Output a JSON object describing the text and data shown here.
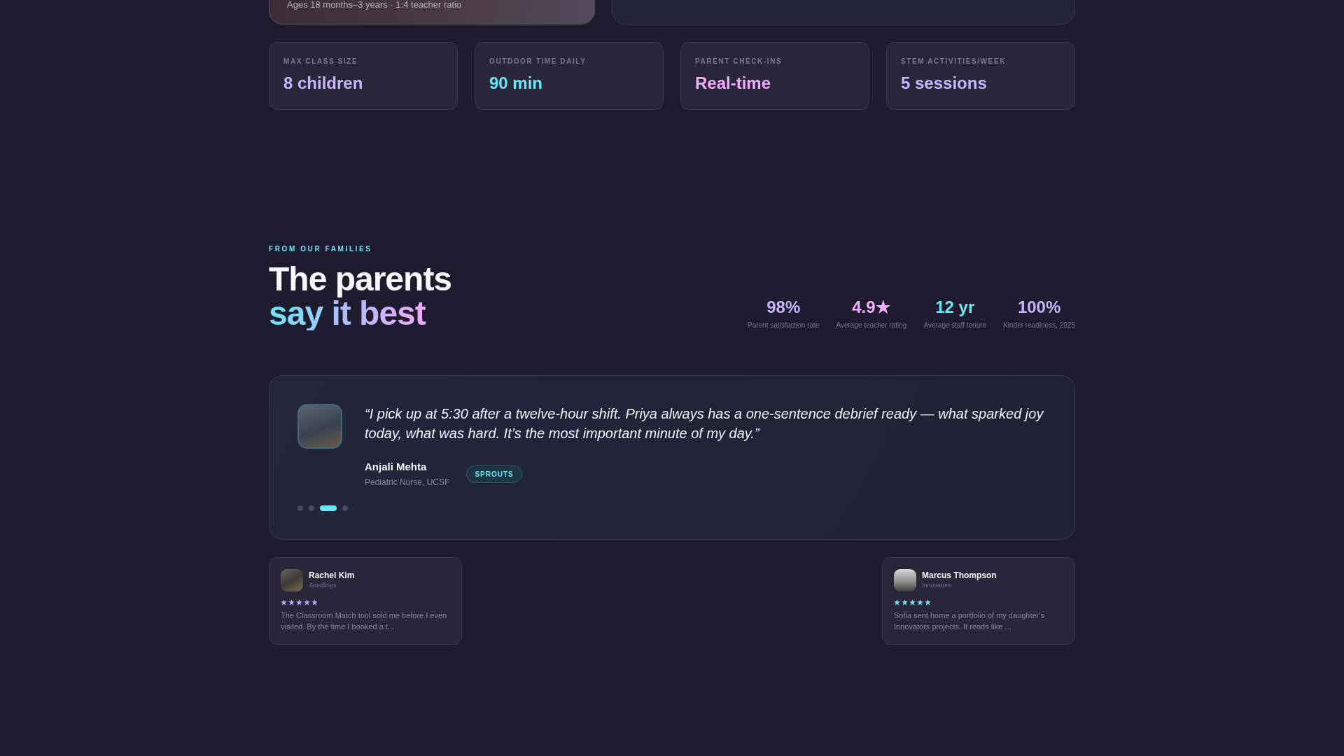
{
  "program_cards": [
    {
      "kind": "photo",
      "caption": "Ages 18 months–3 years · 1:4 teacher ratio"
    },
    {
      "kind": "plain"
    }
  ],
  "highlights": [
    {
      "label": "MAX CLASS SIZE",
      "value": "8 children",
      "color": "#c4b5fd"
    },
    {
      "label": "OUTDOOR TIME DAILY",
      "value": "90 min",
      "color": "#67e8f9"
    },
    {
      "label": "PARENT CHECK-INS",
      "value": "Real-time",
      "color": "#f0abfc"
    },
    {
      "label": "STEM ACTIVITIES/WEEK",
      "value": "5 sessions",
      "color": "#c4b5fd"
    }
  ],
  "testimonials_section": {
    "eyebrow": "FROM OUR FAMILIES",
    "title_line_1": "The parents",
    "title_line_2": "say it best",
    "stats": [
      {
        "value": "98%",
        "label": "Parent satisfaction rate",
        "color": "#c4b5fd"
      },
      {
        "value": "4.9★",
        "label": "Average teacher rating",
        "color": "#f0abfc"
      },
      {
        "value": "12 yr",
        "label": "Average staff tenure",
        "color": "#67e8f9"
      },
      {
        "value": "100%",
        "label": "Kinder readiness, 2025",
        "color": "#c4b5fd"
      }
    ]
  },
  "featured_testimonial": {
    "quote": "“I pick up at 5:30 after a twelve-hour shift. Priya always has a one-sentence debrief ready — what sparked joy today, what was hard. It’s the most important minute of my day.”",
    "name": "Anjali Mehta",
    "role": "Pediatric Nurse, UCSF",
    "badge": "SPROUTS",
    "dots": [
      {
        "selected": false
      },
      {
        "selected": false
      },
      {
        "selected": true
      },
      {
        "selected": false
      }
    ]
  },
  "review_cards": [
    {
      "name": "Rachel Kim",
      "group": "Seedlings",
      "stars": 5,
      "color": "#b9a9f7",
      "text": "The Classroom Match tool sold me before I even visited. By the time I booked a t..."
    },
    {
      "name": "Marcus Thompson",
      "group": "Innovators",
      "stars": 5,
      "color": "#67e8f9",
      "text": "Sofia sent home a portfolio of my daughter's Innovators projects. It reads like ..."
    }
  ]
}
